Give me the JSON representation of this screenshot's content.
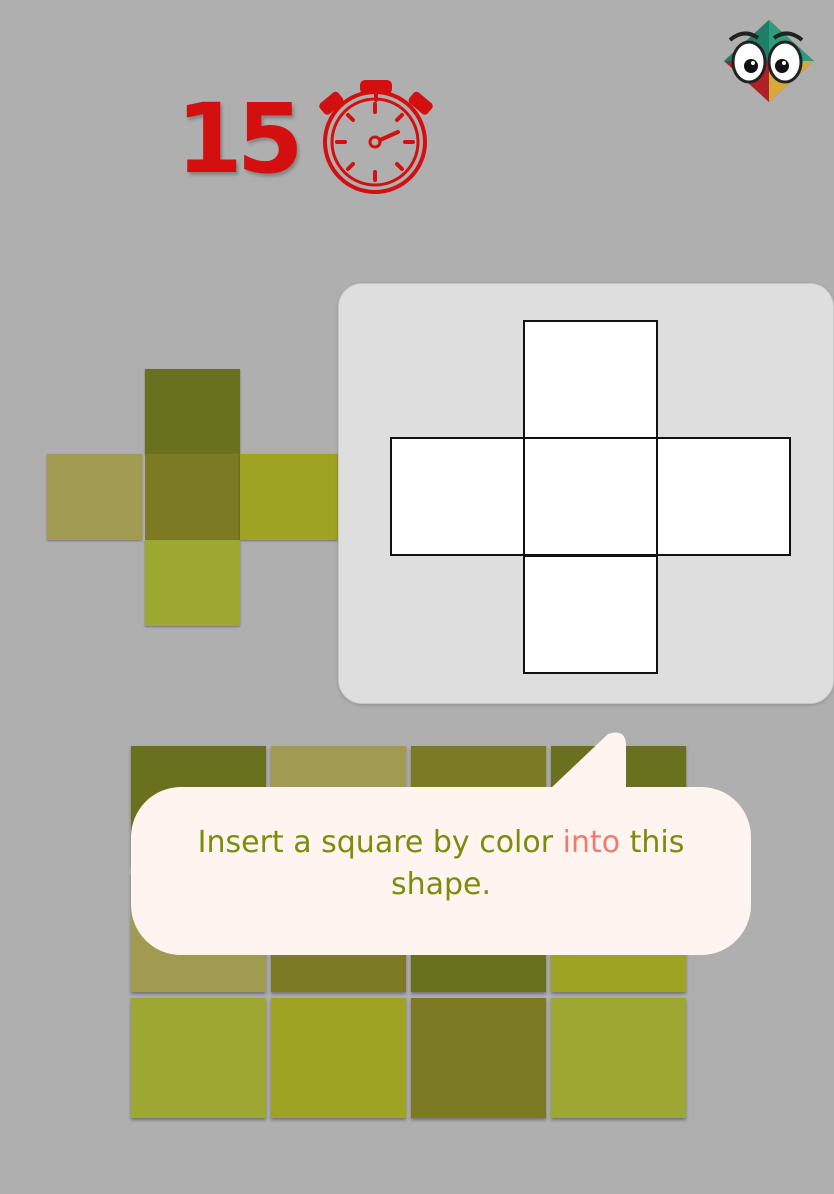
{
  "timer": {
    "seconds": "15",
    "icon": "stopwatch-icon",
    "color": "#d40f0f"
  },
  "mascot": {
    "icon": "eyes-mascot-icon"
  },
  "reference_shape": {
    "cells": [
      {
        "position": "top",
        "color": "#69711f"
      },
      {
        "position": "left",
        "color": "#a09b51"
      },
      {
        "position": "center",
        "color": "#7c7a22"
      },
      {
        "position": "right",
        "color": "#9fa324"
      },
      {
        "position": "bottom",
        "color": "#9da833"
      }
    ]
  },
  "target_shape": {
    "slots": [
      "top",
      "left",
      "center",
      "right",
      "bottom"
    ],
    "filled": 0
  },
  "palette": {
    "rows": [
      [
        "#69711f",
        "#a09b51",
        "#7c7a22",
        "#69711f"
      ],
      [
        "#a09b51",
        "#7c7a22",
        "#69711f",
        "#9fa324"
      ],
      [
        "#9da833",
        "#9fa324",
        "#7c7a22",
        "#9da833"
      ]
    ]
  },
  "hint": {
    "before": "Insert a square by color ",
    "highlight": "into",
    "after": " this shape.",
    "text_color": "#7a8d0c",
    "highlight_color": "#f07a6e"
  }
}
